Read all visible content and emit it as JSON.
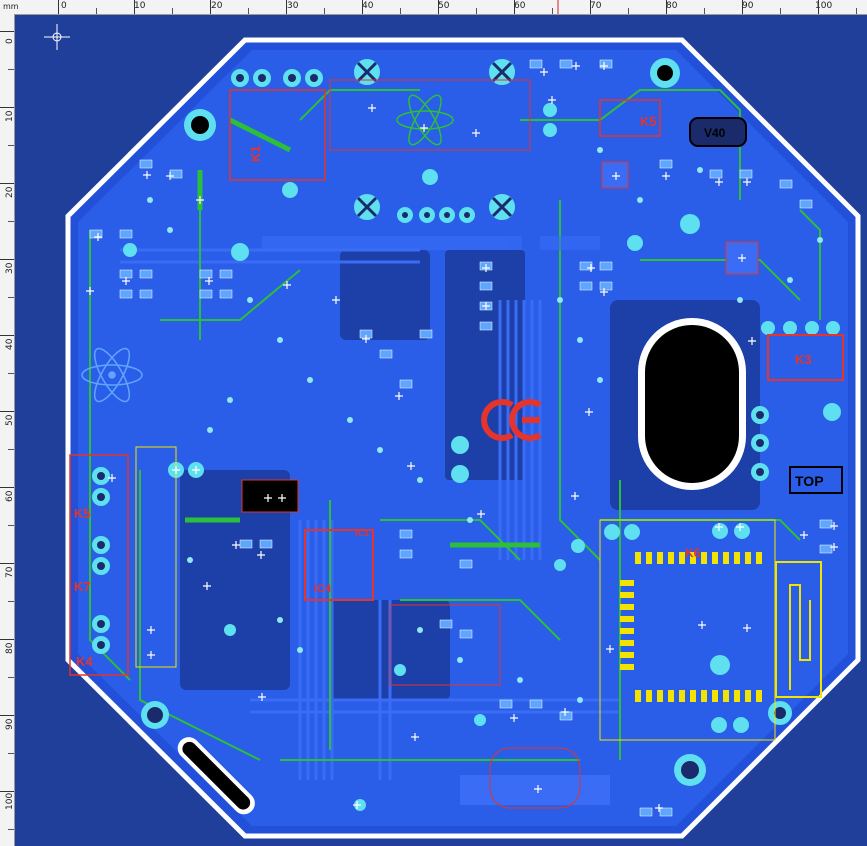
{
  "ruler": {
    "unit": "mm",
    "x_ticks": [
      "0",
      "10",
      "20",
      "30",
      "40",
      "50",
      "60",
      "70",
      "80",
      "90",
      "100"
    ],
    "y_ticks": [
      "0",
      "10",
      "20",
      "30",
      "40",
      "50",
      "60",
      "70",
      "80",
      "90",
      "100"
    ]
  },
  "board": {
    "silkscreen_labels": {
      "top_marker": "TOP",
      "v40_marker": "V40",
      "k1": "K1",
      "k3": "K3",
      "k4": "K4",
      "k5_right": "K5",
      "k5_left": "K5",
      "k6": "K6",
      "k7": "K7",
      "ce_mark": "CE",
      "ic4": "IC4",
      "ic1": "IC1"
    },
    "colors": {
      "background": "#1f3f9a",
      "copper_top": "#2a5ee8",
      "track_bottom": "#2bbf3a",
      "silkscreen": "#e4342c",
      "pad": "#5fe0f0",
      "outline": "#ffffff",
      "antenna": "#f2e400"
    }
  }
}
